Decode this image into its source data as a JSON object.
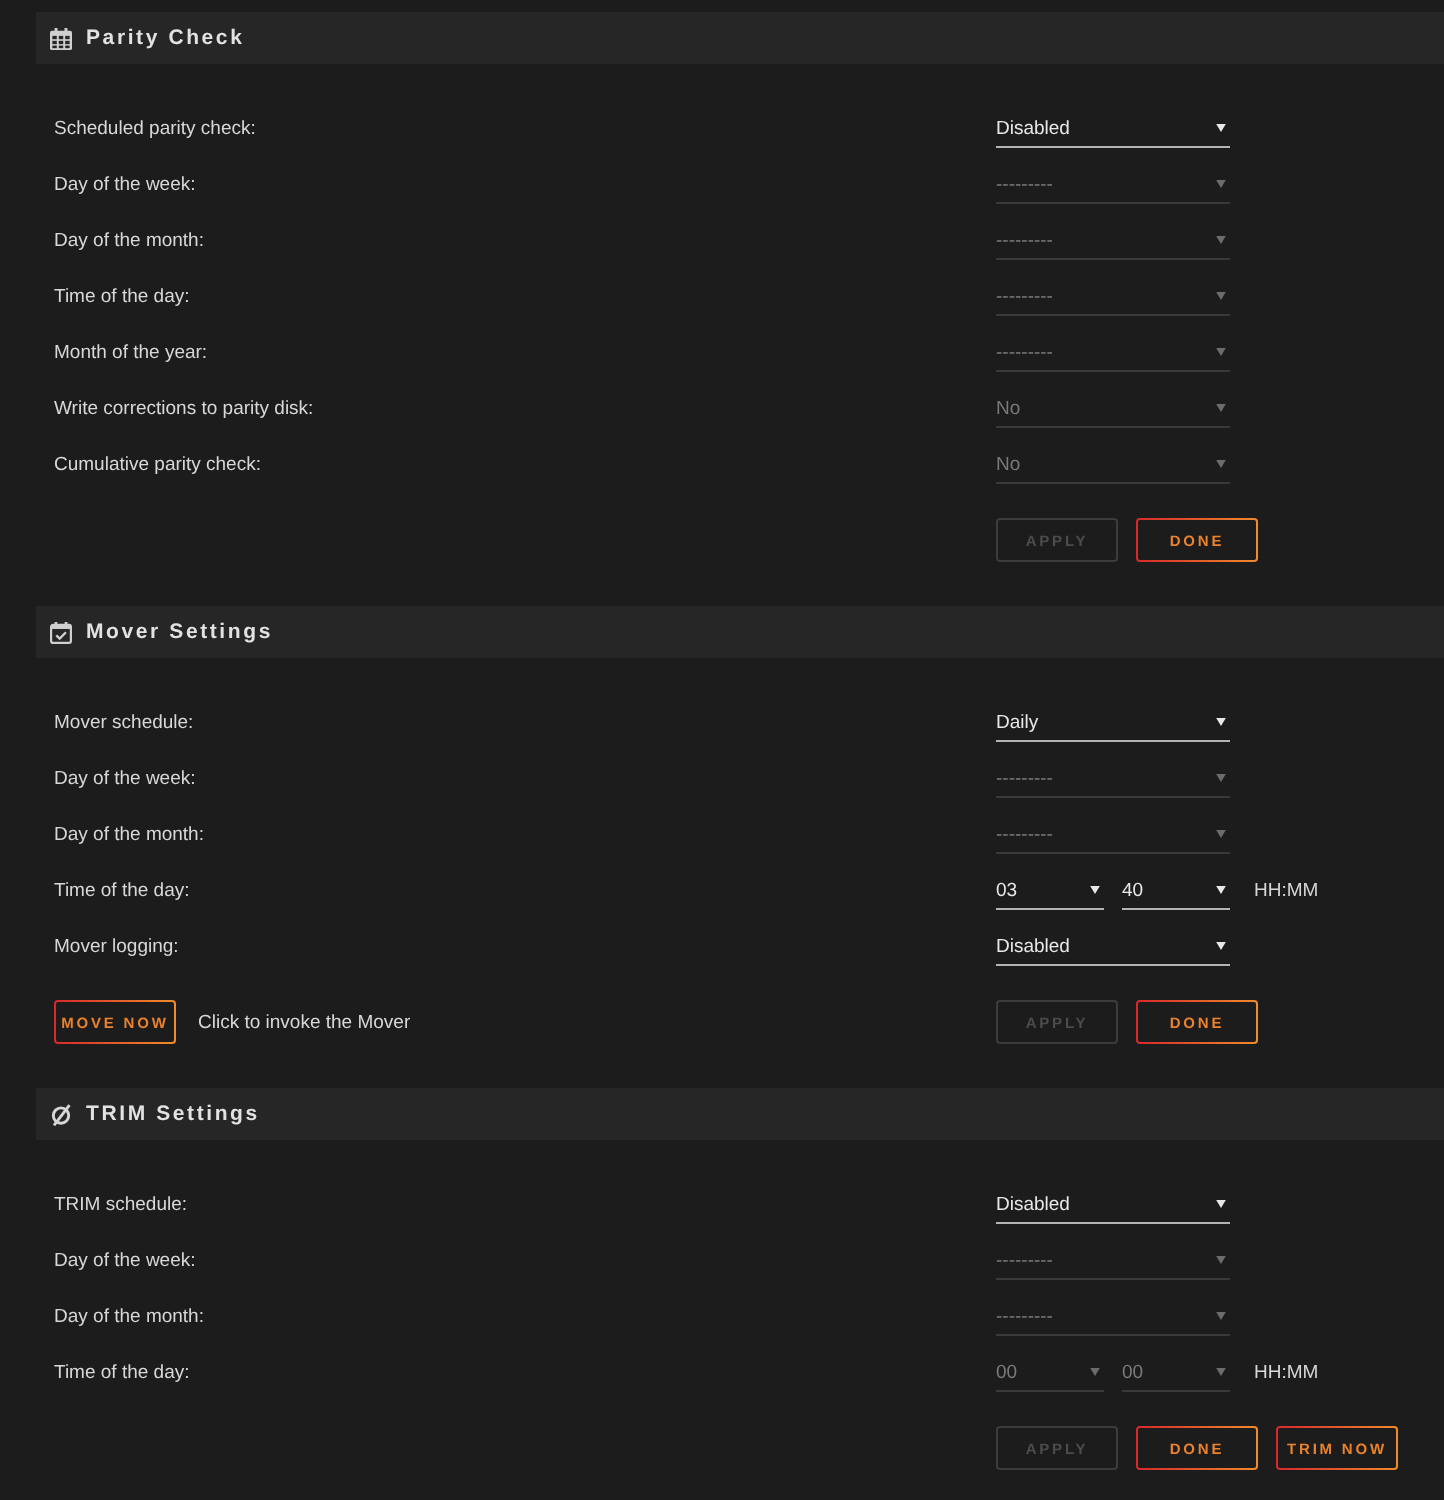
{
  "sections": [
    {
      "title": "Parity Check",
      "fields": [
        {
          "kind": "select",
          "label": "Scheduled parity check:",
          "value": "Disabled",
          "disabled": false
        },
        {
          "kind": "select",
          "label": "Day of the week:",
          "value": "---------",
          "disabled": true
        },
        {
          "kind": "select",
          "label": "Day of the month:",
          "value": "---------",
          "disabled": true
        },
        {
          "kind": "select",
          "label": "Time of the day:",
          "value": "---------",
          "disabled": true
        },
        {
          "kind": "select",
          "label": "Month of the year:",
          "value": "---------",
          "disabled": true
        },
        {
          "kind": "select",
          "label": "Write corrections to parity disk:",
          "value": "No",
          "disabled": true
        },
        {
          "kind": "select",
          "label": "Cumulative parity check:",
          "value": "No",
          "disabled": true
        }
      ],
      "buttons": [
        {
          "label": "APPLY",
          "disabled": true
        },
        {
          "label": "DONE",
          "disabled": false
        }
      ]
    },
    {
      "title": "Mover Settings",
      "fields": [
        {
          "kind": "select",
          "label": "Mover schedule:",
          "value": "Daily",
          "disabled": false
        },
        {
          "kind": "select",
          "label": "Day of the week:",
          "value": "---------",
          "disabled": true
        },
        {
          "kind": "select",
          "label": "Day of the month:",
          "value": "---------",
          "disabled": true
        },
        {
          "kind": "time",
          "label": "Time of the day:",
          "hour": {
            "value": "03",
            "disabled": false
          },
          "minute": {
            "value": "40",
            "disabled": false
          },
          "unit": "HH:MM"
        },
        {
          "kind": "select",
          "label": "Mover logging:",
          "value": "Disabled",
          "disabled": false
        }
      ],
      "invoke": {
        "button": {
          "label": "MOVE NOW",
          "disabled": false
        },
        "note": "Click to invoke the Mover"
      },
      "buttons": [
        {
          "label": "APPLY",
          "disabled": true
        },
        {
          "label": "DONE",
          "disabled": false
        }
      ]
    },
    {
      "title": "TRIM Settings",
      "fields": [
        {
          "kind": "select",
          "label": "TRIM schedule:",
          "value": "Disabled",
          "disabled": false
        },
        {
          "kind": "select",
          "label": "Day of the week:",
          "value": "---------",
          "disabled": true
        },
        {
          "kind": "select",
          "label": "Day of the month:",
          "value": "---------",
          "disabled": true
        },
        {
          "kind": "time",
          "label": "Time of the day:",
          "hour": {
            "value": "00",
            "disabled": true
          },
          "minute": {
            "value": "00",
            "disabled": true
          },
          "unit": "HH:MM"
        }
      ],
      "buttons": [
        {
          "label": "APPLY",
          "disabled": true
        },
        {
          "label": "DONE",
          "disabled": false
        },
        {
          "label": "TRIM NOW",
          "disabled": false
        }
      ]
    }
  ]
}
